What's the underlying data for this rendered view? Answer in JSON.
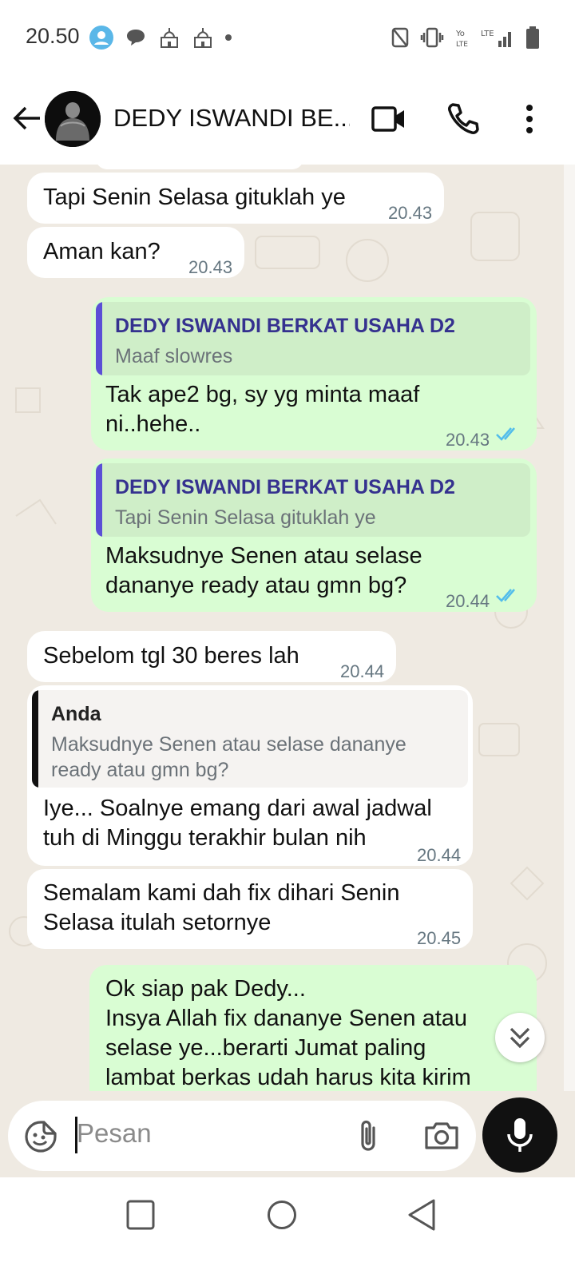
{
  "status_bar": {
    "time": "20.50",
    "icons_left": [
      "account-icon",
      "chat-bubble-icon",
      "mosque-icon",
      "mosque-icon",
      "dot-icon"
    ],
    "icons_right": [
      "nfc-icon",
      "vibrate-icon",
      "volte-icon",
      "lte-signal-icon",
      "battery-icon"
    ]
  },
  "header": {
    "contact_name": "DEDY ISWANDI BE...",
    "icons": [
      "back-arrow-icon",
      "video-call-icon",
      "phone-icon",
      "more-vertical-icon"
    ]
  },
  "messages": [
    {
      "dir": "in",
      "text": "Tapi Senin Selasa gituklah ye",
      "time": "20.43"
    },
    {
      "dir": "in",
      "text": "Aman kan?",
      "time": "20.43"
    },
    {
      "dir": "out",
      "quote_name": "DEDY ISWANDI BERKAT USAHA D2",
      "quote_text": "Maaf slowres",
      "line1": "Tak ape2 bg, sy yg minta maaf",
      "line2": "ni..hehe..",
      "time": "20.43"
    },
    {
      "dir": "out",
      "quote_name": "DEDY ISWANDI BERKAT USAHA D2",
      "quote_text": "Tapi Senin Selasa gituklah ye",
      "line1": "Maksudnye Senen atau selase",
      "line2": "dananye ready atau gmn bg?",
      "time": "20.44"
    },
    {
      "dir": "in",
      "text": "Sebelom tgl 30 beres lah",
      "time": "20.44"
    },
    {
      "dir": "in",
      "quote_name": "Anda",
      "quote_line1": "Maksudnye Senen atau selase dananye",
      "quote_line2": "ready atau gmn bg?",
      "line1": "Iye... Soalnye emang dari awal jadwal",
      "line2": "tuh di Minggu terakhir bulan nih",
      "time": "20.44"
    },
    {
      "dir": "in",
      "line1": "Semalam kami dah fix dihari Senin",
      "line2": "Selasa itulah setornye",
      "time": "20.45"
    },
    {
      "dir": "out",
      "line1": "Ok siap pak Dedy...",
      "line2": "Insya Allah fix dananye Senen atau",
      "line3": "selase ye...berarti Jumat paling",
      "line4": "lambat berkas udah harus kita kirim"
    }
  ],
  "composer": {
    "placeholder": "Pesan",
    "icons": [
      "sticker-icon",
      "attach-icon",
      "camera-icon",
      "mic-icon"
    ]
  },
  "colors": {
    "incoming_bubble": "#ffffff",
    "outgoing_bubble": "#d9fdd3",
    "chat_background": "#efeae2",
    "quote_bar_contact": "#5b4fd6",
    "quote_bar_self": "#111111",
    "read_ticks": "#53bdeb"
  }
}
